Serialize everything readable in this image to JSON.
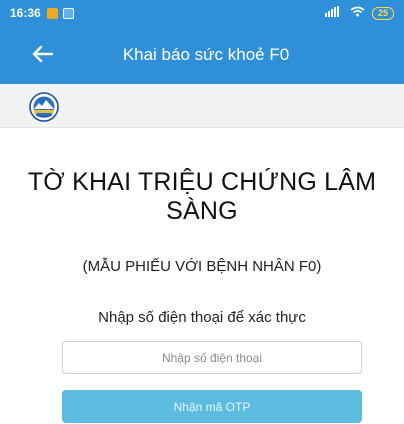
{
  "status_bar": {
    "time": "16:36",
    "battery": "25",
    "accent_color": "#2f8fd8"
  },
  "app_bar": {
    "title": "Khai báo sức khoẻ F0",
    "back_icon": "arrow-left-icon"
  },
  "logo": {
    "icon": "emblem-logo"
  },
  "form": {
    "title": "TỜ KHAI TRIỆU CHỨNG LÂM SÀNG",
    "subtitle": "(MẪU PHIẾU VỚI BỆNH NHÂN F0)",
    "phone_label": "Nhập số điện thoại để xác thực",
    "phone_placeholder": "Nhập số điện thoại",
    "phone_value": "",
    "otp_button_label": "Nhận mã OTP",
    "otp_button_color": "#5bbce0"
  }
}
